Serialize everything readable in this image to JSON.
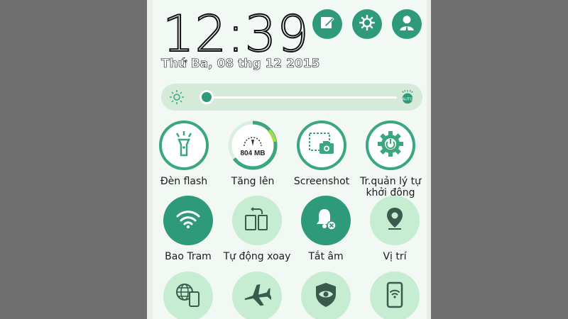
{
  "clock": {
    "time": "12:39",
    "date": "Thứ Ba, 08 thg 12 2015"
  },
  "top_actions": [
    {
      "icon": "edit-icon"
    },
    {
      "icon": "gear-icon"
    },
    {
      "icon": "user-icon"
    }
  ],
  "brightness": {
    "level": 0.03,
    "auto_label": "AUTO"
  },
  "tiles_row1": [
    {
      "label": "Đèn flash",
      "icon": "flashlight-icon"
    },
    {
      "label": "Tăng lên",
      "icon": "gauge-icon",
      "value": "804 MB",
      "progress": 0.65
    },
    {
      "label": "Screenshot",
      "icon": "screenshot-icon"
    },
    {
      "label": "Tr.quản lý tự khởi động",
      "icon": "power-gear-icon"
    }
  ],
  "tiles_row2": [
    {
      "label": "Bao Tram",
      "icon": "wifi-icon",
      "active": true
    },
    {
      "label": "Tự động xoay",
      "icon": "rotate-icon",
      "active": false
    },
    {
      "label": "Tắt âm",
      "icon": "bell-mute-icon",
      "active": true
    },
    {
      "label": "Vị trí",
      "icon": "location-icon",
      "active": false
    }
  ],
  "tiles_row3": [
    {
      "icon": "globe-phone-icon"
    },
    {
      "icon": "airplane-icon"
    },
    {
      "icon": "eye-shield-icon"
    },
    {
      "icon": "phone-wifi-icon"
    }
  ],
  "colors": {
    "accent": "#2f9a79",
    "light_tile": "#c6edd1",
    "panel_bg": "#f2f8f4"
  }
}
